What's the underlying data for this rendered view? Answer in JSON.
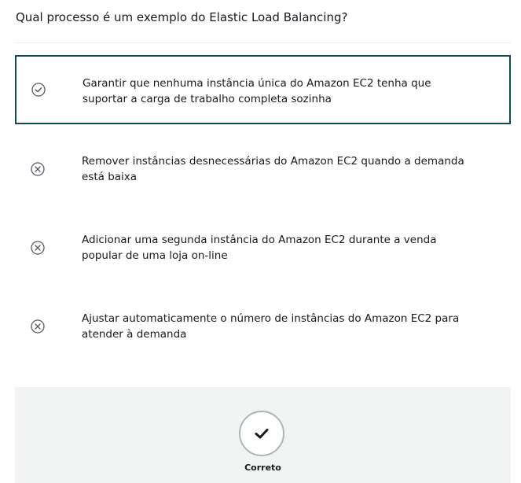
{
  "question": "Qual processo é um exemplo do Elastic Load Balancing?",
  "options": [
    {
      "text": "Garantir que nenhuma instância única do Amazon EC2 tenha que suportar a carga de trabalho completa sozinha",
      "state": "selected-correct",
      "icon": "check-circle-icon"
    },
    {
      "text": "Remover instâncias desnecessárias do Amazon EC2 quando a demanda está baixa",
      "state": "unselected",
      "icon": "x-circle-icon"
    },
    {
      "text": "Adicionar uma segunda instância do Amazon EC2 durante a venda popular de uma loja on-line",
      "state": "unselected",
      "icon": "x-circle-icon"
    },
    {
      "text": "Ajustar automaticamente o número de instâncias do Amazon EC2 para atender à demanda",
      "state": "unselected",
      "icon": "x-circle-icon"
    }
  ],
  "result": {
    "label": "Correto",
    "icon": "checkmark-icon"
  },
  "colors": {
    "selected_border": "#0f4b5b",
    "icon_stroke": "#545b64",
    "result_panel_bg": "#f2f3f3",
    "divider": "#eaeded"
  }
}
